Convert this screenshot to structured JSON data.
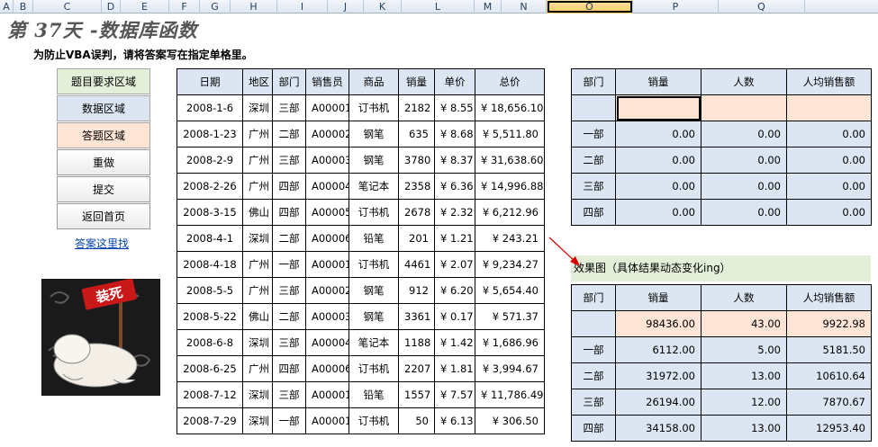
{
  "col_headers": [
    "A",
    "B",
    "C",
    "D",
    "E",
    "F",
    "G",
    "H",
    "I",
    "J",
    "K",
    "L",
    "M",
    "N",
    "O",
    "P",
    "Q"
  ],
  "selected_col": "O",
  "title": "第 37天 -数据库函数",
  "instruction": "为防止VBA误判，请将答案写在指定单格里。",
  "legend": {
    "question": "题目要求区域",
    "data": "数据区域",
    "answer": "答题区域"
  },
  "buttons": {
    "redo": "重做",
    "submit": "提交",
    "home": "返回首页"
  },
  "answer_link": "答案这里找",
  "stamp_text": "装死",
  "colors": {
    "blue": "#dce6f2",
    "peach": "#fde4d5",
    "green": "#e4efd9",
    "selected_header": "#f6c964"
  },
  "data_table": {
    "headers": [
      "日期",
      "地区",
      "部门",
      "销售员",
      "商品",
      "销量",
      "单价",
      "总价"
    ],
    "rows": [
      [
        "2008-1-6",
        "深圳",
        "三部",
        "A00001",
        "订书机",
        "2182",
        "¥ 8.55",
        "¥ 18,656.10"
      ],
      [
        "2008-1-23",
        "广州",
        "二部",
        "A00002",
        "钢笔",
        "635",
        "¥ 8.68",
        "¥ 5,511.80"
      ],
      [
        "2008-2-9",
        "广州",
        "三部",
        "A00003",
        "钢笔",
        "3780",
        "¥ 8.37",
        "¥ 31,638.60"
      ],
      [
        "2008-2-26",
        "广州",
        "四部",
        "A00004",
        "笔记本",
        "2358",
        "¥ 6.36",
        "¥ 14,996.88"
      ],
      [
        "2008-3-15",
        "佛山",
        "四部",
        "A00005",
        "订书机",
        "2678",
        "¥ 2.32",
        "¥ 6,212.96"
      ],
      [
        "2008-4-1",
        "深圳",
        "二部",
        "A00006",
        "铅笔",
        "201",
        "¥ 1.21",
        "¥ 243.21"
      ],
      [
        "2008-4-18",
        "广州",
        "一部",
        "A00001",
        "订书机",
        "4461",
        "¥ 2.07",
        "¥ 9,234.27"
      ],
      [
        "2008-5-5",
        "广州",
        "三部",
        "A00002",
        "钢笔",
        "912",
        "¥ 6.20",
        "¥ 5,654.40"
      ],
      [
        "2008-5-22",
        "佛山",
        "二部",
        "A00003",
        "钢笔",
        "3361",
        "¥ 0.17",
        "¥ 571.37"
      ],
      [
        "2008-6-8",
        "深圳",
        "三部",
        "A00004",
        "笔记本",
        "1188",
        "¥ 1.42",
        "¥ 1,686.96"
      ],
      [
        "2008-6-25",
        "广州",
        "四部",
        "A00006",
        "订书机",
        "2207",
        "¥ 1.81",
        "¥ 3,994.67"
      ],
      [
        "2008-7-12",
        "深圳",
        "三部",
        "A00001",
        "铅笔",
        "1557",
        "¥ 7.57",
        "¥ 11,786.49"
      ],
      [
        "2008-7-29",
        "深圳",
        "一部",
        "A00001",
        "订书机",
        "50",
        "¥ 6.13",
        "¥ 306.50"
      ]
    ]
  },
  "answer_table": {
    "headers": [
      "部门",
      "销量",
      "人数",
      "人均销售额"
    ],
    "total_row": [
      "",
      "",
      "",
      ""
    ],
    "rows": [
      [
        "一部",
        "0.00",
        "0.00",
        "0.00"
      ],
      [
        "二部",
        "0.00",
        "0.00",
        "0.00"
      ],
      [
        "三部",
        "0.00",
        "0.00",
        "0.00"
      ],
      [
        "四部",
        "0.00",
        "0.00",
        "0.00"
      ]
    ]
  },
  "effect_title": "效果图（具体结果动态变化ing）",
  "result_table": {
    "headers": [
      "部门",
      "销量",
      "人数",
      "人均销售额"
    ],
    "total_row": [
      "",
      "98436.00",
      "43.00",
      "9922.98"
    ],
    "rows": [
      [
        "一部",
        "6112.00",
        "5.00",
        "5181.50"
      ],
      [
        "二部",
        "31972.00",
        "13.00",
        "10610.64"
      ],
      [
        "三部",
        "26194.00",
        "12.00",
        "7870.67"
      ],
      [
        "四部",
        "34158.00",
        "13.00",
        "12953.40"
      ]
    ]
  }
}
